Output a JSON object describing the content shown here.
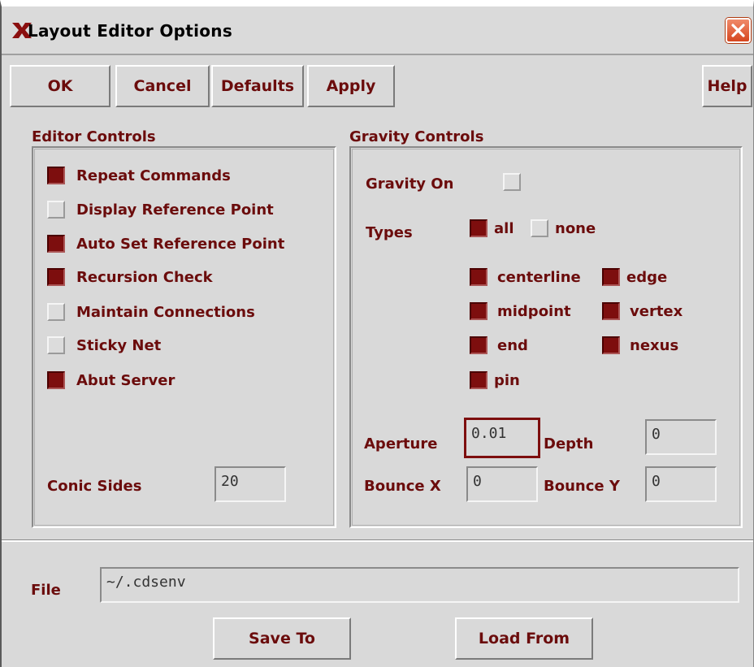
{
  "window": {
    "title": "Layout Editor Options"
  },
  "toolbar": {
    "ok": "OK",
    "cancel": "Cancel",
    "defaults": "Defaults",
    "apply": "Apply",
    "help": "Help"
  },
  "editor_controls": {
    "title": "Editor Controls",
    "options": [
      {
        "label": "Repeat Commands",
        "checked": true
      },
      {
        "label": "Display Reference Point",
        "checked": false
      },
      {
        "label": "Auto Set Reference Point",
        "checked": true
      },
      {
        "label": "Recursion Check",
        "checked": true
      },
      {
        "label": "Maintain Connections",
        "checked": false
      },
      {
        "label": "Sticky Net",
        "checked": false
      },
      {
        "label": "Abut Server",
        "checked": true
      }
    ],
    "conic_sides": {
      "label": "Conic Sides",
      "value": "20"
    }
  },
  "gravity_controls": {
    "title": "Gravity Controls",
    "gravity_on": {
      "label": "Gravity On",
      "checked": false
    },
    "types_label": "Types",
    "types_all": {
      "label": "all",
      "checked": true
    },
    "types_none": {
      "label": "none",
      "checked": false
    },
    "types": [
      {
        "label": "centerline",
        "checked": true
      },
      {
        "label": "edge",
        "checked": true
      },
      {
        "label": "midpoint",
        "checked": true
      },
      {
        "label": "vertex",
        "checked": true
      },
      {
        "label": "end",
        "checked": true
      },
      {
        "label": "nexus",
        "checked": true
      },
      {
        "label": "pin",
        "checked": true
      }
    ],
    "aperture": {
      "label": "Aperture",
      "value": "0.01"
    },
    "depth": {
      "label": "Depth",
      "value": "0"
    },
    "bounce_x": {
      "label": "Bounce X",
      "value": "0"
    },
    "bounce_y": {
      "label": "Bounce Y",
      "value": "0"
    }
  },
  "file": {
    "label": "File",
    "value": "~/.cdsenv",
    "save_to": "Save To",
    "load_from": "Load From"
  },
  "colors": {
    "accent": "#7d0e0e",
    "label_text": "#6b0c0c",
    "background": "#d9d9d9"
  }
}
